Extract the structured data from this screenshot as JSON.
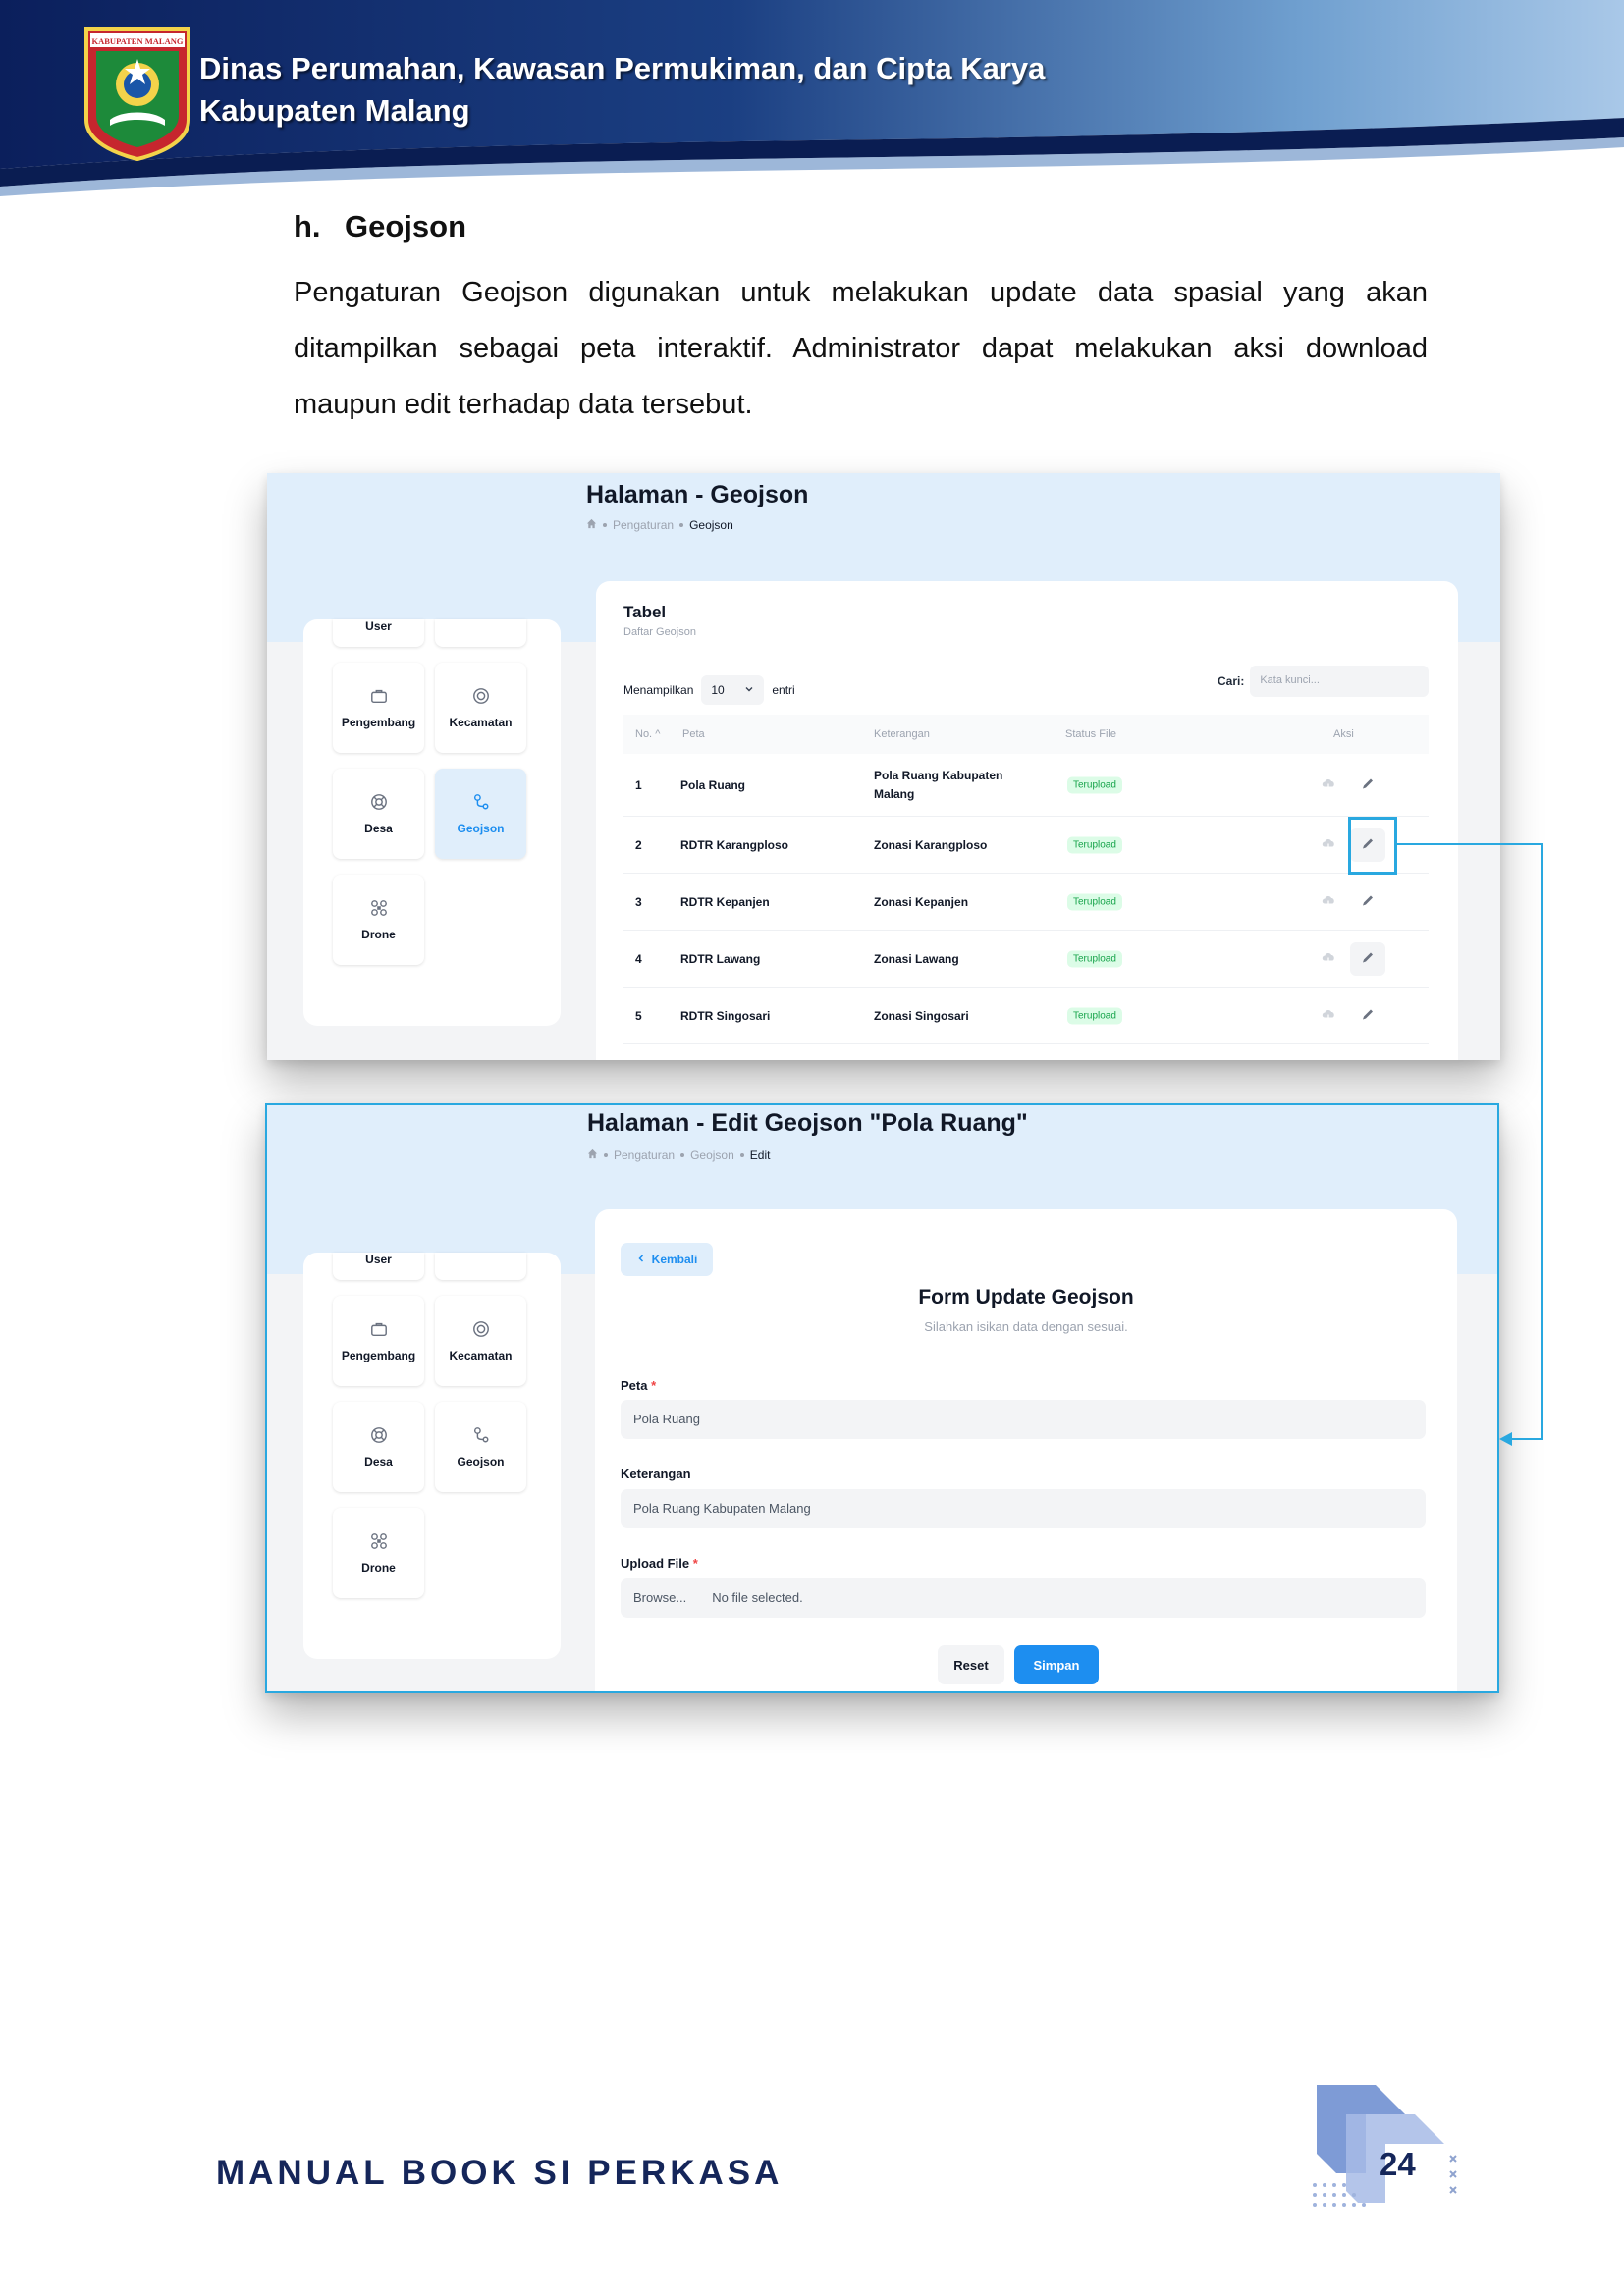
{
  "header": {
    "logo_text": "KABUPATEN MALANG",
    "org_line1": "Dinas Perumahan, Kawasan Permukiman, dan Cipta Karya",
    "org_line2": "Kabupaten Malang"
  },
  "section": {
    "number": "h.",
    "title": "Geojson",
    "paragraph": "Pengaturan Geojson digunakan untuk melakukan update data spasial yang akan ditampilkan sebagai peta interaktif. Administrator dapat melakukan aksi download maupun edit terhadap data tersebut."
  },
  "menu": {
    "user": "User",
    "pengembang": "Pengembang",
    "kecamatan": "Kecamatan",
    "desa": "Desa",
    "geojson": "Geojson",
    "drone": "Drone"
  },
  "screen1": {
    "page_title": "Halaman - Geojson",
    "breadcrumb": [
      "Pengaturan",
      "Geojson"
    ],
    "table_title": "Tabel",
    "table_subtitle": "Daftar Geojson",
    "show_label": "Menampilkan",
    "show_value": "10",
    "show_suffix": "entri",
    "search_label": "Cari:",
    "search_placeholder": "Kata kunci...",
    "columns": [
      "No.",
      "Peta",
      "Keterangan",
      "Status File",
      "Aksi"
    ],
    "rows": [
      {
        "no": "1",
        "peta": "Pola Ruang",
        "ket": "Pola Ruang Kabupaten Malang",
        "status": "Terupload"
      },
      {
        "no": "2",
        "peta": "RDTR Karangploso",
        "ket": "Zonasi Karangploso",
        "status": "Terupload"
      },
      {
        "no": "3",
        "peta": "RDTR Kepanjen",
        "ket": "Zonasi Kepanjen",
        "status": "Terupload"
      },
      {
        "no": "4",
        "peta": "RDTR Lawang",
        "ket": "Zonasi Lawang",
        "status": "Terupload"
      },
      {
        "no": "5",
        "peta": "RDTR Singosari",
        "ket": "Zonasi Singosari",
        "status": "Terupload"
      }
    ]
  },
  "screen2": {
    "page_title": "Halaman - Edit Geojson \"Pola Ruang\"",
    "breadcrumb": [
      "Pengaturan",
      "Geojson",
      "Edit"
    ],
    "back_label": "Kembali",
    "form_title": "Form Update Geojson",
    "form_subtitle": "Silahkan isikan data dengan sesuai.",
    "peta_label": "Peta",
    "peta_value": "Pola Ruang",
    "keterangan_label": "Keterangan",
    "keterangan_value": "Pola Ruang Kabupaten Malang",
    "upload_label": "Upload File",
    "browse_label": "Browse...",
    "no_file": "No file selected.",
    "reset_label": "Reset",
    "save_label": "Simpan",
    "required_mark": "*"
  },
  "footer": {
    "title": "MANUAL BOOK SI PERKASA",
    "page_number": "24"
  },
  "colors": {
    "accent": "#1d8ef0",
    "highlight": "#29a8e0",
    "navy": "#15265a",
    "success": "#16a34a"
  }
}
